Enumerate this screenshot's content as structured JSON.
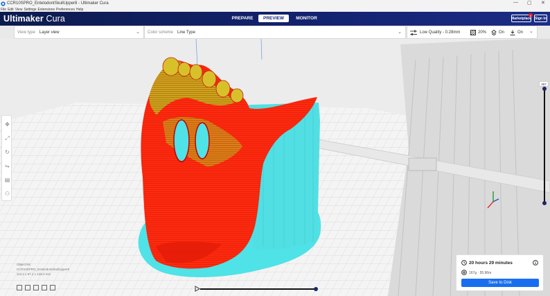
{
  "window": {
    "title": "CCR10SPRO_EntelodontSkullUpper8 - Ultimaker Cura",
    "controls": [
      "—",
      "▢",
      "✕"
    ]
  },
  "menu": [
    "File",
    "Edit",
    "View",
    "Settings",
    "Extensions",
    "Preferences",
    "Help"
  ],
  "header": {
    "logo_bold": "Ultimaker",
    "logo_thin": "Cura",
    "stages": [
      "PREPARE",
      "PREVIEW",
      "MONITOR"
    ],
    "active_stage": "PREVIEW",
    "marketplace_label": "Marketplace",
    "marketplace_badge": "1",
    "signin_label": "Sign In"
  },
  "viewbar": {
    "view_type_label": "View type",
    "view_type_value": "Layer view",
    "color_scheme_label": "Color scheme",
    "color_scheme_value": "Line Type"
  },
  "print_settings": {
    "profile": "Low Quality - 0.28mm",
    "infill": "20%",
    "support": "On",
    "adhesion": "On"
  },
  "layer_slider": {
    "current_layer": "457"
  },
  "object_info": {
    "list_label": "Object list",
    "name": "CCR10SPRO_EntelodontSkullUpper8",
    "dimensions": "113.2 x 97.4 x 128.0 mm"
  },
  "print_info": {
    "time": "20 hours 29 minutes",
    "material": "167g · 55.96m",
    "save_label": "Save to Disk"
  },
  "colors": {
    "header": "#13226e",
    "accent": "#196ef0",
    "wall": "#ff2a0f",
    "support": "#4fe2e6",
    "badge": "#e31b1b"
  }
}
